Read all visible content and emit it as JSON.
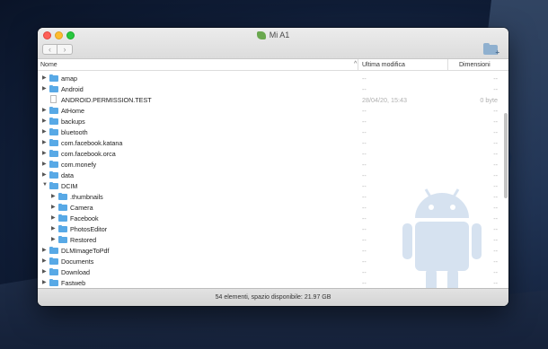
{
  "window": {
    "title": "Mi A1",
    "back_glyph": "‹",
    "forward_glyph": "›",
    "new_folder_icon": "folder-plus-icon"
  },
  "columns": {
    "name": "Nome",
    "modified": "Ultima modifica",
    "size": "Dimensioni",
    "sort_glyph": "^"
  },
  "rows": [
    {
      "name": "amap",
      "type": "folder",
      "depth": 0,
      "expanded": false,
      "modified": "--",
      "size": "--"
    },
    {
      "name": "Android",
      "type": "folder",
      "depth": 0,
      "expanded": false,
      "modified": "--",
      "size": "--"
    },
    {
      "name": "ANDROID.PERMISSION.TEST",
      "type": "file",
      "depth": 0,
      "expanded": false,
      "modified": "28/04/20, 15:43",
      "size": "0 byte"
    },
    {
      "name": "AtHome",
      "type": "folder",
      "depth": 0,
      "expanded": false,
      "modified": "--",
      "size": "--"
    },
    {
      "name": "backups",
      "type": "folder",
      "depth": 0,
      "expanded": false,
      "modified": "--",
      "size": "--"
    },
    {
      "name": "bluetooth",
      "type": "folder",
      "depth": 0,
      "expanded": false,
      "modified": "--",
      "size": "--"
    },
    {
      "name": "com.facebook.katana",
      "type": "folder",
      "depth": 0,
      "expanded": false,
      "modified": "--",
      "size": "--"
    },
    {
      "name": "com.facebook.orca",
      "type": "folder",
      "depth": 0,
      "expanded": false,
      "modified": "--",
      "size": "--"
    },
    {
      "name": "com.monefy",
      "type": "folder",
      "depth": 0,
      "expanded": false,
      "modified": "--",
      "size": "--"
    },
    {
      "name": "data",
      "type": "folder",
      "depth": 0,
      "expanded": false,
      "modified": "--",
      "size": "--"
    },
    {
      "name": "DCIM",
      "type": "folder",
      "depth": 0,
      "expanded": true,
      "modified": "--",
      "size": "--"
    },
    {
      "name": ".thumbnails",
      "type": "folder",
      "depth": 1,
      "expanded": false,
      "modified": "--",
      "size": "--"
    },
    {
      "name": "Camera",
      "type": "folder",
      "depth": 1,
      "expanded": false,
      "modified": "--",
      "size": "--"
    },
    {
      "name": "Facebook",
      "type": "folder",
      "depth": 1,
      "expanded": false,
      "modified": "--",
      "size": "--"
    },
    {
      "name": "PhotosEditor",
      "type": "folder",
      "depth": 1,
      "expanded": false,
      "modified": "--",
      "size": "--"
    },
    {
      "name": "Restored",
      "type": "folder",
      "depth": 1,
      "expanded": false,
      "modified": "--",
      "size": "--"
    },
    {
      "name": "DLMImageToPdf",
      "type": "folder",
      "depth": 0,
      "expanded": false,
      "modified": "--",
      "size": "--"
    },
    {
      "name": "Documents",
      "type": "folder",
      "depth": 0,
      "expanded": false,
      "modified": "--",
      "size": "--"
    },
    {
      "name": "Download",
      "type": "folder",
      "depth": 0,
      "expanded": false,
      "modified": "--",
      "size": "--"
    },
    {
      "name": "Fastweb",
      "type": "folder",
      "depth": 0,
      "expanded": false,
      "modified": "--",
      "size": "--"
    }
  ],
  "status": {
    "text": "54 elementi, spazio disponibile: 21.97 GB"
  },
  "colors": {
    "folder": "#58a9e6",
    "close": "#fe5f57",
    "minimize": "#febc2e",
    "maximize": "#28c840"
  }
}
